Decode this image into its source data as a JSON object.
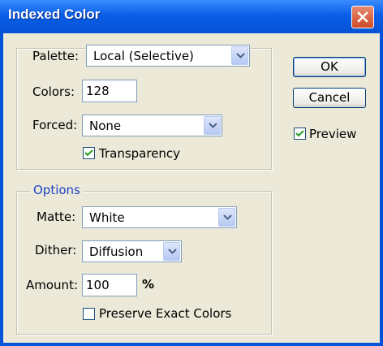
{
  "window": {
    "title": "Indexed Color"
  },
  "palette_group": {
    "palette_label": "Palette:",
    "palette_value": "Local (Selective)",
    "colors_label": "Colors:",
    "colors_value": "128",
    "forced_label": "Forced:",
    "forced_value": "None",
    "transparency_label": "Transparency",
    "transparency_checked": true
  },
  "options_group": {
    "legend": "Options",
    "matte_label": "Matte:",
    "matte_value": "White",
    "dither_label": "Dither:",
    "dither_value": "Diffusion",
    "amount_label": "Amount:",
    "amount_value": "100",
    "amount_unit": "%",
    "preserve_label": "Preserve Exact Colors",
    "preserve_checked": false
  },
  "buttons": {
    "ok": "OK",
    "cancel": "Cancel"
  },
  "preview": {
    "label": "Preview",
    "checked": true
  },
  "colors": {
    "titlebar": "#0553d6",
    "legend_text": "#1e44c8",
    "dialog_bg": "#ece9d8"
  }
}
